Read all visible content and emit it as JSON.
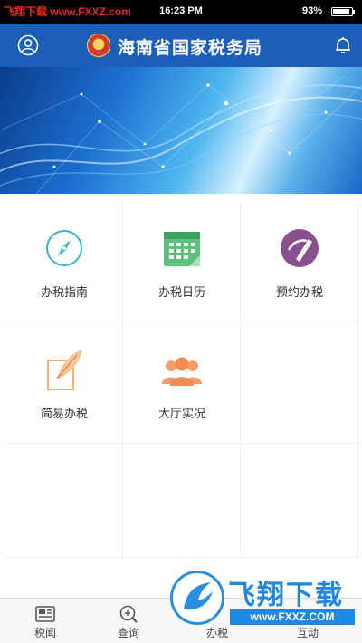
{
  "status_bar": {
    "watermark": "飞翔下载 www.FXXZ.com",
    "time": "16:23 PM",
    "battery": "93%"
  },
  "header": {
    "title": "海南省国家税务局",
    "left_icon": "user-icon",
    "right_icon": "bell-icon"
  },
  "grid": {
    "items": [
      {
        "label": "办税指南",
        "icon": "compass-icon"
      },
      {
        "label": "办税日历",
        "icon": "calendar-icon"
      },
      {
        "label": "预约办税",
        "icon": "appointment-icon"
      },
      {
        "label": "简易办税",
        "icon": "quill-icon"
      },
      {
        "label": "大厅实况",
        "icon": "people-icon"
      }
    ]
  },
  "tabs": [
    {
      "label": "税闻",
      "icon": "news-icon"
    },
    {
      "label": "查询",
      "icon": "search-icon"
    },
    {
      "label": "办税",
      "icon": "task-icon"
    },
    {
      "label": "互动",
      "icon": "chat-icon"
    }
  ],
  "watermark": {
    "brand": "飞翔下载",
    "url": "www.FXXZ.COM"
  },
  "colors": {
    "header_bg": "#1c5fb8",
    "accent_blue": "#1e88e5"
  }
}
